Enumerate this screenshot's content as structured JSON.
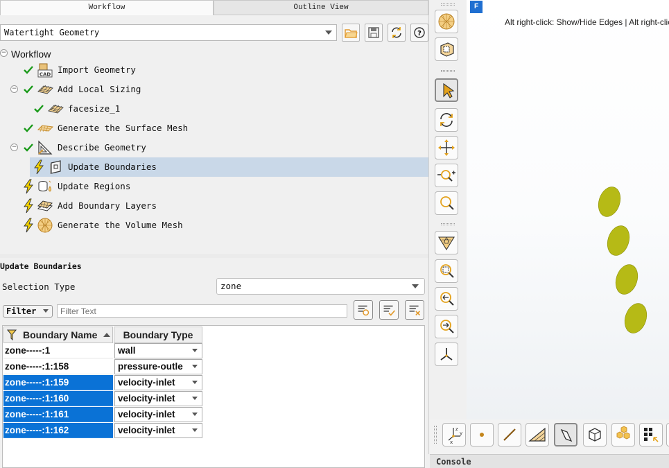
{
  "tabs": [
    {
      "label": "Workflow",
      "active": true
    },
    {
      "label": "Outline View",
      "active": false
    }
  ],
  "workflow_combo": {
    "value": "Watertight Geometry"
  },
  "tree": {
    "root_label": "Workflow",
    "items": [
      {
        "label": "Import Geometry",
        "status": "done",
        "icon": "cad-import-icon"
      },
      {
        "label": "Add Local Sizing",
        "status": "done",
        "icon": "mesh-grid-icon",
        "collapsible": true
      },
      {
        "label": "facesize_1",
        "status": "done",
        "icon": "mesh-grid-icon"
      },
      {
        "label": "Generate the Surface Mesh",
        "status": "done",
        "icon": "surface-mesh-icon"
      },
      {
        "label": "Describe Geometry",
        "status": "done",
        "icon": "triangle-ruler-icon",
        "collapsible": true
      },
      {
        "label": "Update Boundaries",
        "status": "pending",
        "icon": "boundary-icon",
        "selected": true
      },
      {
        "label": "Update Regions",
        "status": "pending",
        "icon": "regions-icon"
      },
      {
        "label": "Add Boundary Layers",
        "status": "pending",
        "icon": "boundary-layers-icon"
      },
      {
        "label": "Generate the Volume Mesh",
        "status": "pending",
        "icon": "volume-mesh-icon"
      }
    ]
  },
  "panel": {
    "title": "Update Boundaries",
    "selection_type_label": "Selection Type",
    "selection_type_value": "zone",
    "filter_label": "Filter",
    "filter_placeholder": "Filter Text"
  },
  "table": {
    "headers": {
      "name": "Boundary Name",
      "type": "Boundary Type"
    },
    "rows": [
      {
        "name": "zone-----:1",
        "type": "wall",
        "selected": false
      },
      {
        "name": "zone-----:1:158",
        "type": "pressure-outle",
        "selected": false
      },
      {
        "name": "zone-----:1:159",
        "type": "velocity-inlet",
        "selected": true
      },
      {
        "name": "zone-----:1:160",
        "type": "velocity-inlet",
        "selected": true
      },
      {
        "name": "zone-----:1:161",
        "type": "velocity-inlet",
        "selected": true
      },
      {
        "name": "zone-----:1:162",
        "type": "velocity-inlet",
        "selected": true
      }
    ]
  },
  "viewport": {
    "badge": "F",
    "hint": "Alt right-click: Show/Hide Edges | Alt right-click"
  },
  "console": {
    "label": "Console"
  },
  "colors": {
    "accent_blue": "#0a72d6",
    "tree_selection": "#c9d8e8",
    "check_green": "#1a9a1a",
    "bolt_yellow": "#f2d200",
    "mesh_tan": "#d6a14a",
    "geometry_olive": "#b6ba16"
  }
}
